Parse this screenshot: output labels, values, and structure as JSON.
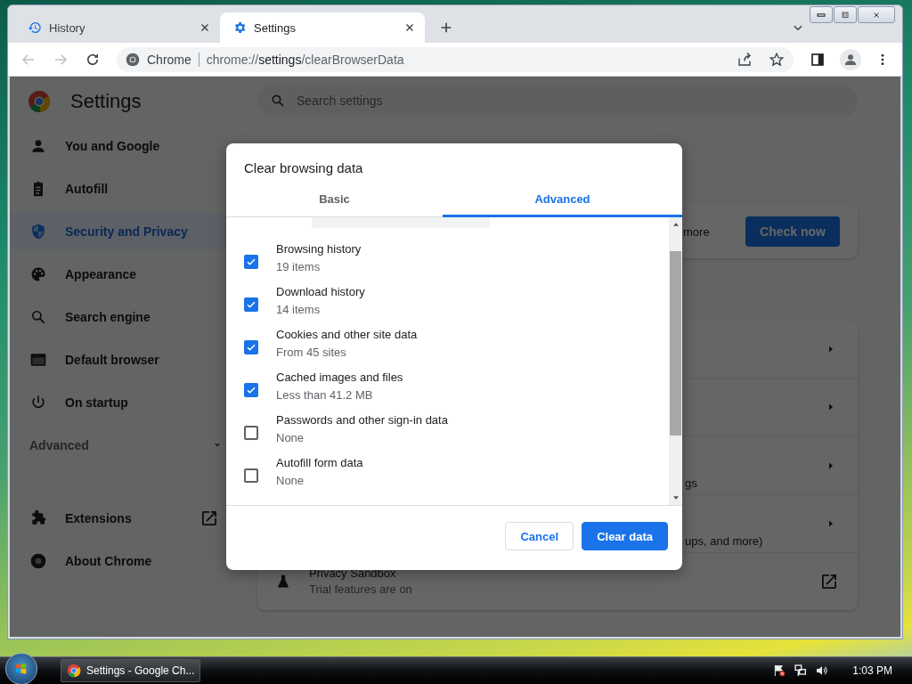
{
  "browser": {
    "tabs": [
      {
        "label": "History",
        "kind": "history",
        "selected": false
      },
      {
        "label": "Settings",
        "kind": "settings",
        "selected": true
      }
    ],
    "address": {
      "origin": "Chrome",
      "url": "chrome://**settings**/clearBrowserData"
    }
  },
  "settings": {
    "title": "Settings",
    "search": {
      "placeholder": "Search settings"
    },
    "sidebar": {
      "items": [
        {
          "label": "You and Google",
          "kind": "person",
          "selected": false
        },
        {
          "label": "Autofill",
          "kind": "clipboard",
          "selected": false
        },
        {
          "label": "Security and Privacy",
          "kind": "shield",
          "selected": true
        },
        {
          "label": "Appearance",
          "kind": "palette",
          "selected": false
        },
        {
          "label": "Search engine",
          "kind": "search",
          "selected": false
        },
        {
          "label": "Default browser",
          "kind": "browser",
          "selected": false
        },
        {
          "label": "On startup",
          "kind": "power",
          "selected": false
        }
      ],
      "advanced": {
        "label": "Advanced",
        "expanded": false
      },
      "links": [
        {
          "label": "Extensions",
          "kind": "puzzle",
          "external": true
        },
        {
          "label": "About Chrome",
          "kind": "chrome",
          "external": false
        }
      ]
    },
    "safety_card": {
      "text": "more",
      "button": "Check now"
    },
    "privacy_rows": [
      {
        "text": "",
        "kind": "arrow"
      },
      {
        "text": "",
        "kind": "arrow"
      },
      {
        "text": "gs",
        "kind": "arrow"
      },
      {
        "text": "ups, and more)",
        "kind": "arrow"
      },
      {
        "title": "Privacy Sandbox",
        "text": "Trial features are on",
        "kind": "external"
      }
    ]
  },
  "dialog": {
    "title": "Clear browsing data",
    "tabs": [
      {
        "label": "Basic",
        "selected": false
      },
      {
        "label": "Advanced",
        "selected": true
      }
    ],
    "items": [
      {
        "label": "Browsing history",
        "detail": "19 items",
        "checked": true
      },
      {
        "label": "Download history",
        "detail": "14 items",
        "checked": true
      },
      {
        "label": "Cookies and other site data",
        "detail": "From 45 sites",
        "checked": true
      },
      {
        "label": "Cached images and files",
        "detail": "Less than 41.2 MB",
        "checked": true
      },
      {
        "label": "Passwords and other sign-in data",
        "detail": "None",
        "checked": false
      },
      {
        "label": "Autofill form data",
        "detail": "None",
        "checked": false
      }
    ],
    "buttons": [
      {
        "label": "Cancel",
        "kind": "secondary"
      },
      {
        "label": "Clear data",
        "kind": "primary"
      }
    ]
  },
  "taskbar": {
    "task": "Settings - Google Ch...",
    "clock": "1:03 PM"
  }
}
